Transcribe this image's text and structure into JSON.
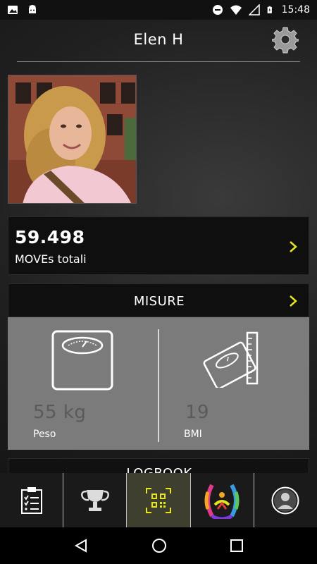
{
  "status_bar": {
    "time": "15:48",
    "left_icons": [
      "image-icon",
      "android-icon"
    ],
    "right_icons": [
      "do-not-disturb-icon",
      "wifi-icon",
      "signal-icon",
      "battery-charging-icon"
    ]
  },
  "header": {
    "title": "Elen H",
    "settings_icon": "gear-icon"
  },
  "profile": {
    "avatar": "profile-photo"
  },
  "moves": {
    "value": "59.498",
    "label": "MOVEs totali"
  },
  "misure": {
    "title": "MISURE",
    "weight": {
      "value": "55 kg",
      "label": "Peso",
      "icon": "scale-icon"
    },
    "bmi": {
      "value": "19",
      "label": "BMI",
      "icon": "scale-ruler-icon"
    }
  },
  "logbook": {
    "title": "LOGBOOK"
  },
  "bottom_nav": {
    "items": [
      {
        "name": "clipboard-icon",
        "active": false
      },
      {
        "name": "trophy-icon",
        "active": false
      },
      {
        "name": "qr-code-icon",
        "active": true
      },
      {
        "name": "colorful-logo-icon",
        "active": false
      },
      {
        "name": "user-icon",
        "active": false
      }
    ]
  },
  "system_nav": [
    "back-icon",
    "home-icon",
    "recents-icon"
  ],
  "colors": {
    "accent": "#e6e61a",
    "card_bg": "#0f0f0f",
    "misure_bg": "#7b7b7b",
    "active_nav": "#3e3f2e"
  }
}
